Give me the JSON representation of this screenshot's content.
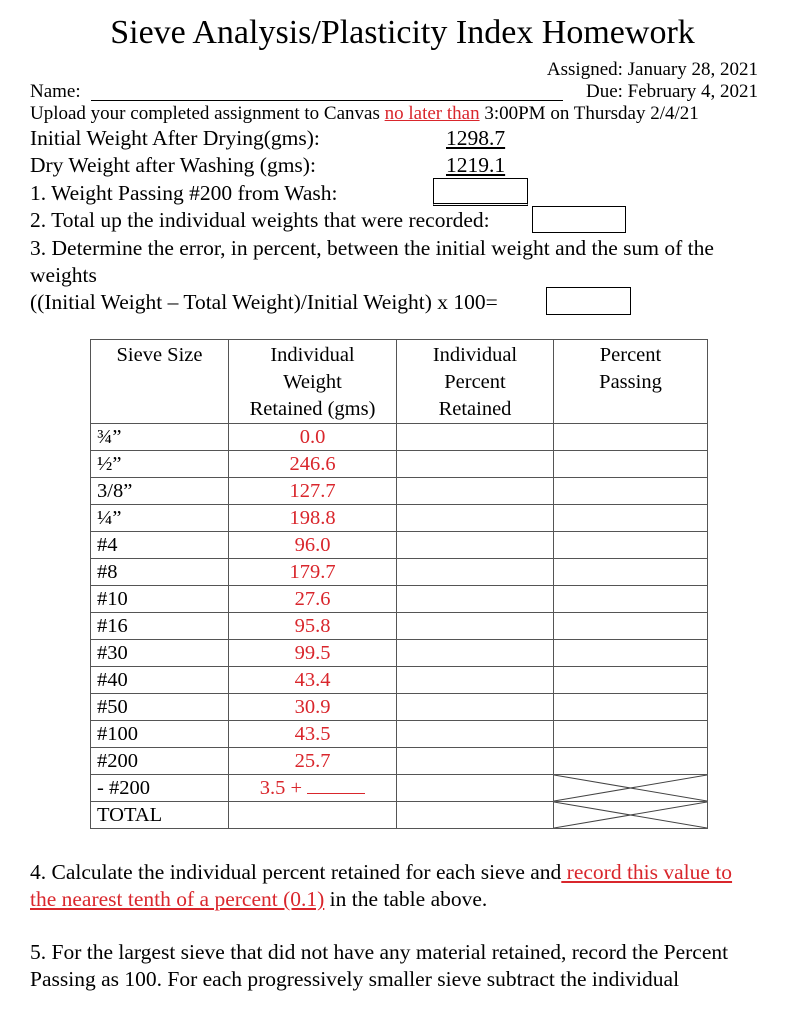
{
  "header": {
    "title": "Sieve Analysis/Plasticity Index Homework",
    "assigned": "Assigned: January 28, 2021",
    "name_label": "Name:",
    "name_blank": "__________________________________________________",
    "due": "Due:   February 4, 2021",
    "upload_prefix": "Upload your completed assignment to Canvas ",
    "upload_highlight": "no later than",
    "upload_suffix": " 3:00PM on Thursday 2/4/21"
  },
  "weights": {
    "initial_label": "Initial Weight After Drying(gms):",
    "initial_value": "1298.7",
    "dry_label": "Dry Weight after Washing (gms):",
    "dry_value": "1219.1"
  },
  "questions": {
    "q1": "1. Weight Passing #200 from Wash:",
    "q2": "2. Total up the individual weights that were recorded:",
    "q3_line1": "3. Determine the error, in percent, between the initial weight and the sum of the",
    "q3_line2": "weights",
    "q3_formula": "((Initial Weight – Total Weight)/Initial Weight) x 100=",
    "q4_prefix": "4. Calculate the individual percent retained for each sieve and",
    "q4_highlight_1": " record this value to",
    "q4_highlight_2": "the nearest tenth of a percent (0.1)",
    "q4_suffix": " in the table above.",
    "q5_line1": "5. For the largest sieve that did not have any material retained, record the Percent",
    "q5_line2": "Passing as 100. For each progressively smaller sieve subtract the individual"
  },
  "table": {
    "headers": [
      "Sieve Size",
      "Individual Weight Retained (gms)",
      "Individual Percent Retained",
      "Percent Passing"
    ],
    "header_lines": {
      "c1": [
        "Sieve Size"
      ],
      "c2": [
        "Individual",
        "Weight",
        "Retained (gms)"
      ],
      "c3": [
        "Individual",
        "Percent",
        "Retained"
      ],
      "c4": [
        "Percent",
        "Passing"
      ]
    },
    "rows": [
      {
        "sieve": "¾”",
        "weight": "0.0"
      },
      {
        "sieve": "½”",
        "weight": "246.6"
      },
      {
        "sieve": "3/8”",
        "weight": "127.7"
      },
      {
        "sieve": "¼”",
        "weight": "198.8"
      },
      {
        "sieve": "#4",
        "weight": "96.0"
      },
      {
        "sieve": "#8",
        "weight": "179.7"
      },
      {
        "sieve": "#10",
        "weight": "27.6"
      },
      {
        "sieve": "#16",
        "weight": "95.8"
      },
      {
        "sieve": "#30",
        "weight": "99.5"
      },
      {
        "sieve": "#40",
        "weight": "43.4"
      },
      {
        "sieve": "#50",
        "weight": "30.9"
      },
      {
        "sieve": "#100",
        "weight": "43.5"
      },
      {
        "sieve": "#200",
        "weight": "25.7"
      }
    ],
    "pan_row": {
      "sieve": "- #200",
      "weight": "3.5 +"
    },
    "total_row": {
      "sieve": "TOTAL"
    }
  },
  "colors": {
    "accent_red": "#d9262c"
  }
}
